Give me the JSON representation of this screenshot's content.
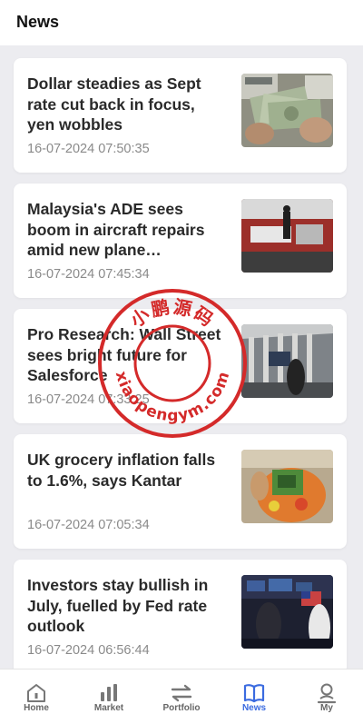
{
  "header": {
    "title": "News"
  },
  "news": [
    {
      "title": "Dollar steadies as Sept rate cut back in focus, yen wobbles",
      "time": "16-07-2024 07:50:35",
      "image": "dollar-bills-image"
    },
    {
      "title": "Malaysia's ADE sees boom in aircraft repairs amid new plane…",
      "time": "16-07-2024 07:45:34",
      "image": "aircraft-repair-image"
    },
    {
      "title": "Pro Research: Wall Street sees bright future for Salesforce",
      "time": "16-07-2024 07:33:25",
      "image": "wall-street-image"
    },
    {
      "title": "UK grocery inflation falls to 1.6%, says Kantar",
      "time": "16-07-2024 07:05:34",
      "image": "grocery-bag-image"
    },
    {
      "title": "Investors stay bullish in July, fuelled by Fed rate outlook",
      "time": "16-07-2024 06:56:44",
      "image": "trading-floor-image"
    }
  ],
  "watermark": {
    "top_text": "小鹏源码",
    "bottom_text": "xiaopengym.com",
    "color": "#d42a2a"
  },
  "tabs": [
    {
      "label": "Home",
      "icon": "home-icon"
    },
    {
      "label": "Market",
      "icon": "bar-chart-icon"
    },
    {
      "label": "Portfolio",
      "icon": "swap-arrows-icon"
    },
    {
      "label": "News",
      "icon": "book-icon",
      "active": true
    },
    {
      "label": "My",
      "icon": "person-icon"
    }
  ],
  "colors": {
    "accent": "#3b6be0",
    "background": "#ececf0",
    "card": "#ffffff",
    "timestamp": "#8a8a8a"
  }
}
